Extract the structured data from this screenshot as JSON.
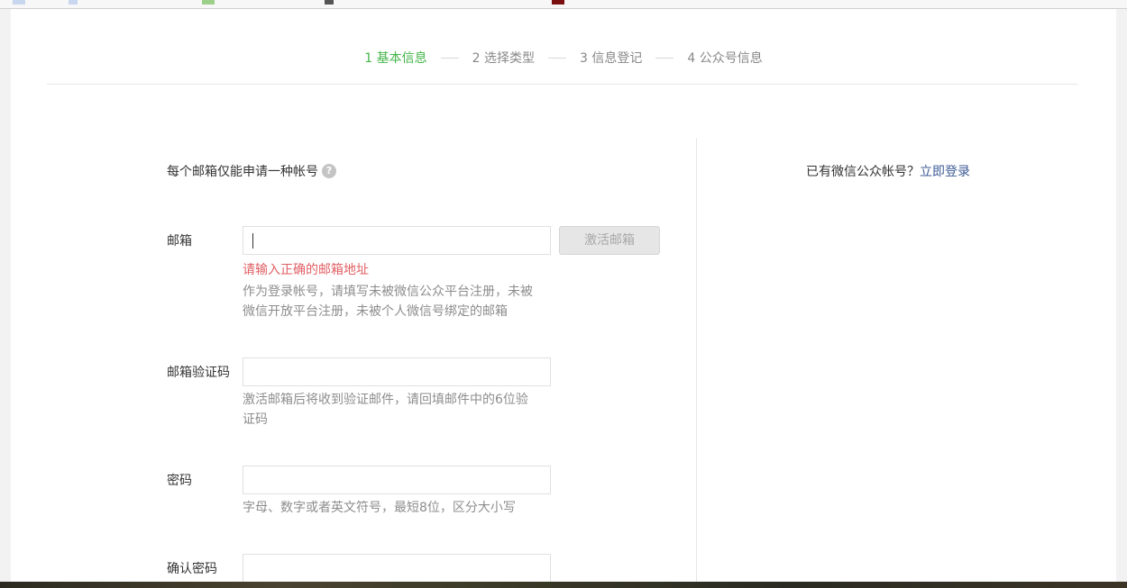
{
  "steps": [
    {
      "label": "1 基本信息",
      "active": true
    },
    {
      "label": "2 选择类型",
      "active": false
    },
    {
      "label": "3 信息登记",
      "active": false
    },
    {
      "label": "4 公众号信息",
      "active": false
    }
  ],
  "notice": {
    "text": "每个邮箱仅能申请一种帐号"
  },
  "login_hint": {
    "prefix": "已有微信公众帐号？",
    "link": "立即登录"
  },
  "form": {
    "email": {
      "label": "邮箱",
      "value": "",
      "activate_label": "激活邮箱",
      "error": "请输入正确的邮箱地址",
      "tip": "作为登录帐号，请填写未被微信公众平台注册，未被微信开放平台注册，未被个人微信号绑定的邮箱"
    },
    "email_code": {
      "label": "邮箱验证码",
      "value": "",
      "tip": "激活邮箱后将收到验证邮件，请回填邮件中的6位验证码"
    },
    "password": {
      "label": "密码",
      "value": "",
      "tip": "字母、数字或者英文符号，最短8位，区分大小写"
    },
    "confirm_password": {
      "label": "确认密码",
      "value": ""
    }
  },
  "colors": {
    "accent": "#44b549",
    "link": "#3c5a96",
    "error": "#e15f63"
  }
}
